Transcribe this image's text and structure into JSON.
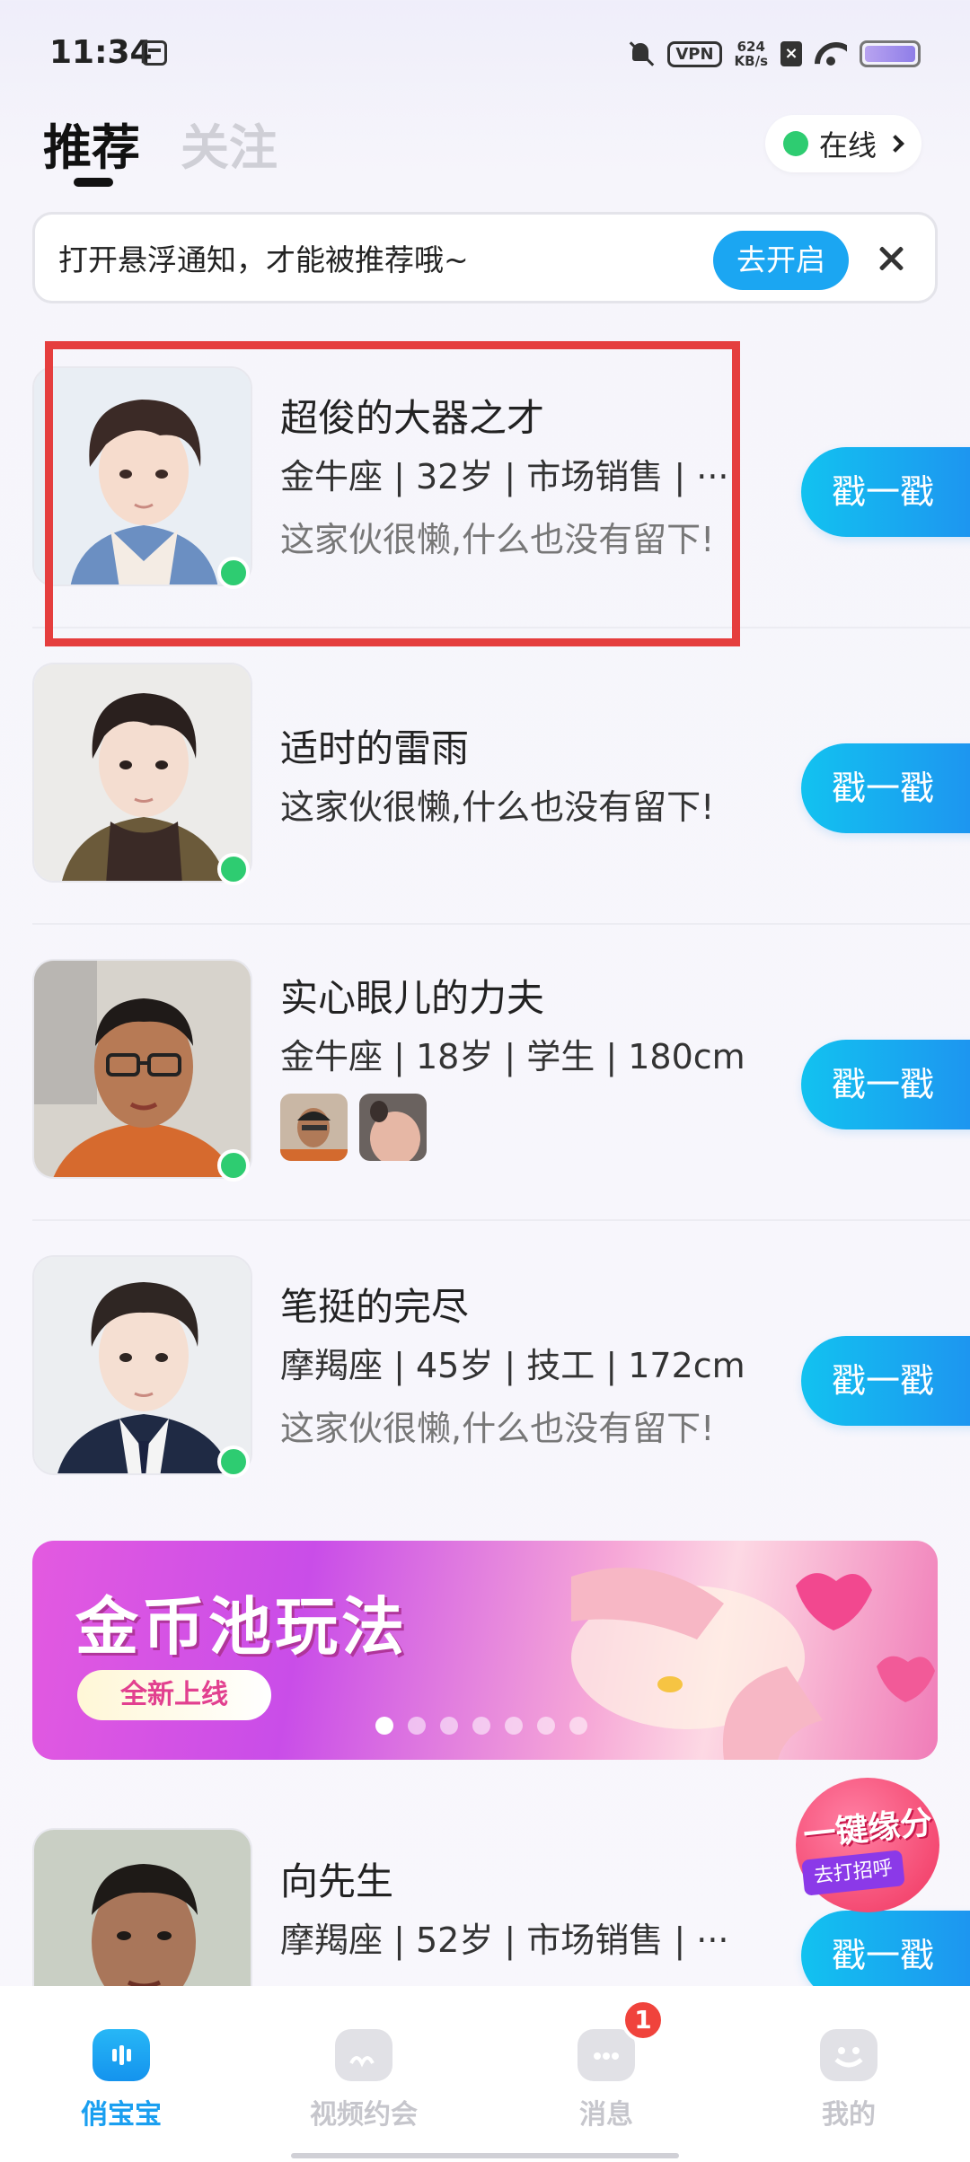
{
  "status_bar": {
    "time": "11:34",
    "vpn": "VPN",
    "speed_value": "624",
    "speed_unit": "KB/s"
  },
  "header": {
    "tabs": [
      {
        "label": "推荐",
        "active": true
      },
      {
        "label": "关注",
        "active": false
      }
    ],
    "online_label": "在线"
  },
  "notice": {
    "text": "打开悬浮通知，才能被推荐哦~",
    "button": "去开启"
  },
  "users": [
    {
      "name": "超俊的大器之才",
      "meta": "金牛座 | 32岁 |  市场销售 | ···",
      "bio": "这家伙很懒,什么也没有留下!",
      "online": true
    },
    {
      "name": "适时的雷雨",
      "meta": "",
      "bio": "这家伙很懒,什么也没有留下!",
      "online": true
    },
    {
      "name": "实心眼儿的力夫",
      "meta": "金牛座 | 18岁 | 学生 | 180cm",
      "bio": "",
      "online": true,
      "photo_count": 2
    },
    {
      "name": "笔挺的完尽",
      "meta": "摩羯座 | 45岁 |  技工 | 172cm",
      "bio": "这家伙很懒,什么也没有留下!",
      "online": true
    },
    {
      "name": "向先生",
      "meta": "摩羯座 | 52岁 | 市场销售 | ···",
      "bio": "",
      "online": false
    }
  ],
  "poke_label": "戳一戳",
  "banner": {
    "title": "金币池玩法",
    "tag": "全新上线",
    "dot_count": 7,
    "active_dot": 0
  },
  "float_badge": {
    "title": "一键缘分",
    "subtitle": "去打招呼"
  },
  "bottom_nav": [
    {
      "label": "俏宝宝",
      "icon": "home-bubble-icon",
      "active": true
    },
    {
      "label": "视频约会",
      "icon": "video-icon",
      "active": false
    },
    {
      "label": "消息",
      "icon": "message-icon",
      "active": false,
      "badge": "1"
    },
    {
      "label": "我的",
      "icon": "profile-icon",
      "active": false
    }
  ],
  "colors": {
    "accent": "#1ba6f2",
    "online": "#2ecc71",
    "highlight": "#e53e3e",
    "badge": "#f0433c"
  }
}
